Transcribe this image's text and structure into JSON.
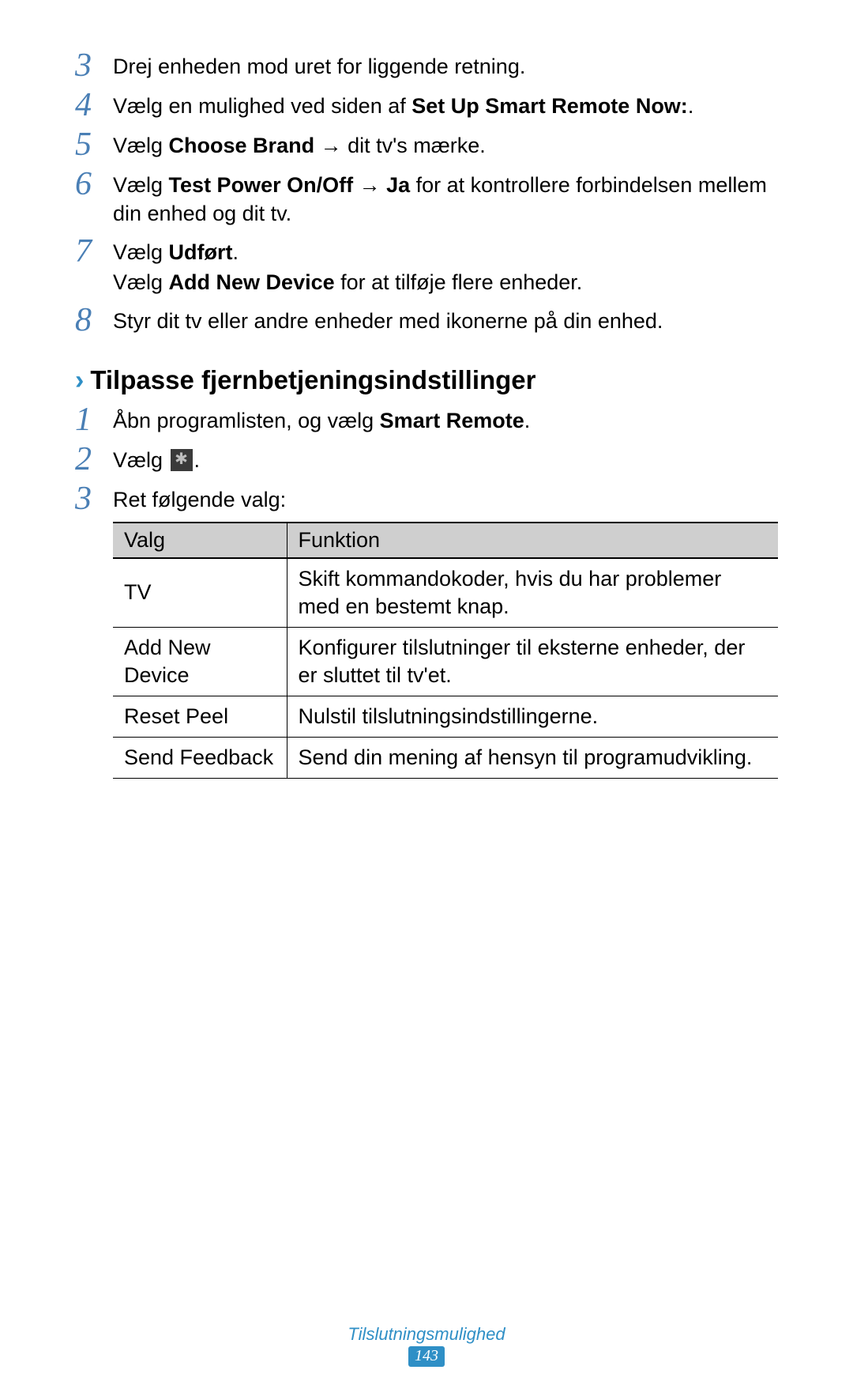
{
  "steps_a": [
    {
      "num": "3",
      "html": "Drej enheden mod uret for liggende retning."
    },
    {
      "num": "4",
      "html": "Vælg en mulighed ved siden af <b>Set Up Smart Remote Now:</b>."
    },
    {
      "num": "5",
      "html": "Vælg <b>Choose Brand</b> → dit tv's mærke."
    },
    {
      "num": "6",
      "html": "Vælg <b>Test Power On/Off</b> → <b>Ja</b> for at kontrollere forbindelsen mellem din enhed og dit tv."
    },
    {
      "num": "7",
      "html": "Vælg <b>Udført</b>.",
      "sub": "Vælg <b>Add New Device</b> for at tilføje flere enheder."
    },
    {
      "num": "8",
      "html": "Styr dit tv eller andre enheder med ikonerne på din enhed."
    }
  ],
  "section": {
    "chevron": "›",
    "title": "Tilpasse fjernbetjeningsindstillinger"
  },
  "steps_b": [
    {
      "num": "1",
      "html": "Åbn programlisten, og vælg <b>Smart Remote</b>."
    },
    {
      "num": "2",
      "html": "Vælg <span class=\"gear-icon\" data-name=\"gear-icon\" data-interactable=\"false\"></span>."
    },
    {
      "num": "3",
      "html": "Ret følgende valg:"
    }
  ],
  "table": {
    "headers": [
      "Valg",
      "Funktion"
    ],
    "rows": [
      [
        "TV",
        "Skift kommandokoder, hvis du har problemer med en bestemt knap."
      ],
      [
        "Add New Device",
        "Konfigurer tilslutninger til eksterne enheder, der er sluttet til tv'et."
      ],
      [
        "Reset Peel",
        "Nulstil tilslutningsindstillingerne."
      ],
      [
        "Send Feedback",
        "Send din mening af hensyn til programudvikling."
      ]
    ]
  },
  "footer": {
    "category": "Tilslutningsmulighed",
    "page": "143"
  }
}
